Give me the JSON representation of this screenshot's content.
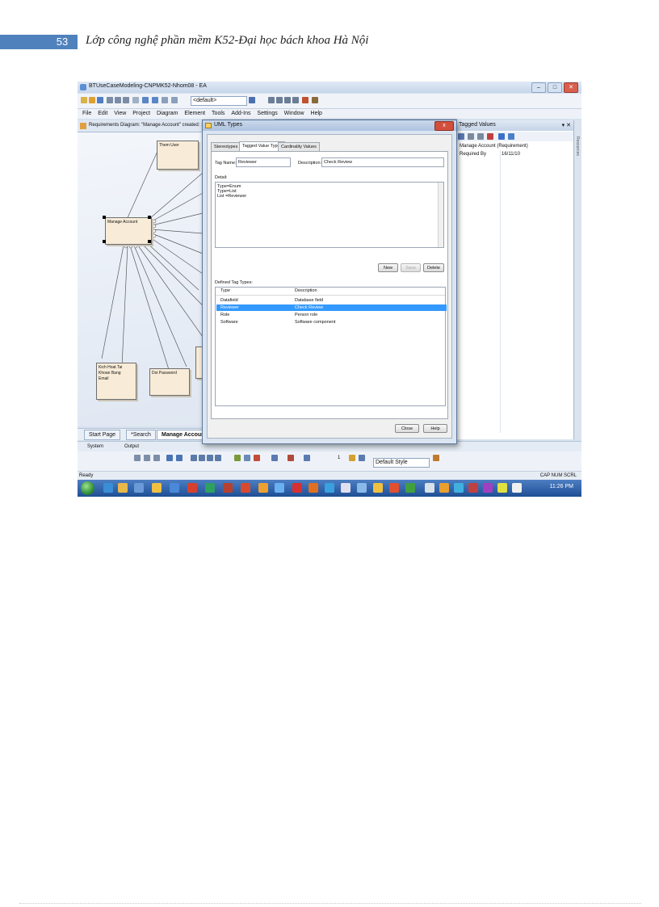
{
  "header": {
    "page_number": "53",
    "title": "Lớp công nghệ phần mềm K52-Đại học bách khoa Hà Nội"
  },
  "app": {
    "window_title": "BTUseCaseModeling-CNPMK52-Nhom08 - EA",
    "style_combo": "<default>",
    "menu": [
      "File",
      "Edit",
      "View",
      "Project",
      "Diagram",
      "Element",
      "Tools",
      "Add-Ins",
      "Settings",
      "Window",
      "Help"
    ],
    "diagram_header": "Requirements Diagram: \"Manage Account\"  created: 10/10/2",
    "elements": {
      "them_user": "Them User",
      "manage_account": "Manage Account",
      "kich_hoat": [
        "Kich Hoat Tai",
        "Khoan Bang",
        "Email"
      ],
      "doi_password": "Doi Password"
    },
    "diagram_tabs": [
      "Start Page",
      "*Search",
      "Manage Account"
    ],
    "output_tabs": [
      "System",
      "Output"
    ],
    "line_width": "1",
    "default_style": "Default Style",
    "status_left": "Ready",
    "status_right": "CAP  NUM  SCRL",
    "clock": "11:26 PM",
    "side_strip_label": "Resources"
  },
  "tagged_values": {
    "title": "Tagged Values",
    "item": "Manage Account (Requirement)",
    "rows": [
      {
        "name": "Required By",
        "value": "16/11/10"
      }
    ]
  },
  "dialog": {
    "title": "UML Types",
    "close_glyph": "x",
    "tabs": [
      "Stereotypes",
      "Tagged Value Types",
      "Cardinality Values"
    ],
    "active_tab": 1,
    "tag_name_label": "Tag Name:",
    "tag_name_value": "Reviewer",
    "description_label": "Description:",
    "description_value": "Check Review",
    "detail_label": "Detail:",
    "detail_lines": [
      "Type=Enum",
      "Type=List",
      "List =Reviewer"
    ],
    "buttons": {
      "new": "New",
      "save": "Save",
      "delete": "Delete",
      "close": "Close",
      "help": "Help"
    },
    "defined_label": "Defined Tag Types:",
    "columns": [
      "Type",
      "Description"
    ],
    "rows": [
      {
        "type": "Datafield",
        "description": "Database field"
      },
      {
        "type": "Reviewer",
        "description": "Check Review"
      },
      {
        "type": "Role",
        "description": "Person role"
      },
      {
        "type": "Software",
        "description": "Software component"
      }
    ],
    "selected_row": 1
  },
  "colors": {
    "header_accent": "#4f81bd",
    "selection": "#3399ff",
    "use_case_fill": "#f8ecd8",
    "taskbar": "#1e4f95"
  }
}
